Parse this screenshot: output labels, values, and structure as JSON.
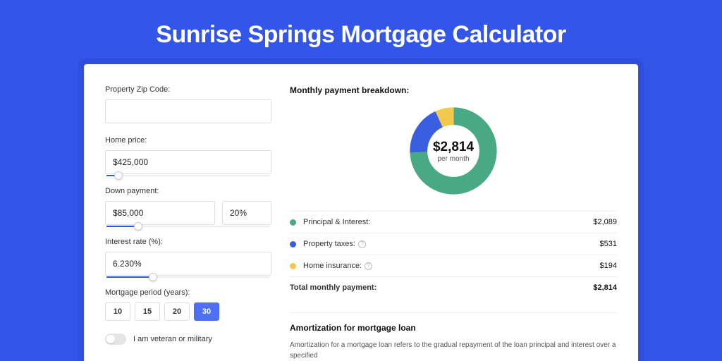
{
  "title": "Sunrise Springs Mortgage Calculator",
  "colors": {
    "green": "#4aa985",
    "blue": "#3a5ee0",
    "yellow": "#f2c94c"
  },
  "form": {
    "zip": {
      "label": "Property Zip Code:",
      "value": ""
    },
    "price": {
      "label": "Home price:",
      "value": "$425,000",
      "slider_pct": 8
    },
    "down": {
      "label": "Down payment:",
      "amount": "$85,000",
      "percent": "20%",
      "slider_pct": 20
    },
    "rate": {
      "label": "Interest rate (%):",
      "value": "6.230%",
      "slider_pct": 29
    },
    "period": {
      "label": "Mortgage period (years):",
      "options": [
        "10",
        "15",
        "20",
        "30"
      ],
      "selected": "30"
    },
    "veteran": {
      "label": "I am veteran or military",
      "on": false
    }
  },
  "breakdown": {
    "title": "Monthly payment breakdown:",
    "center_amount": "$2,814",
    "center_sub": "per month",
    "items": [
      {
        "name": "Principal & Interest:",
        "value": "$2,089",
        "color": "#4aa985",
        "help": false
      },
      {
        "name": "Property taxes:",
        "value": "$531",
        "color": "#3a5ee0",
        "help": true
      },
      {
        "name": "Home insurance:",
        "value": "$194",
        "color": "#f2c94c",
        "help": true
      }
    ],
    "total": {
      "label": "Total monthly payment:",
      "value": "$2,814"
    }
  },
  "chart_data": {
    "type": "pie",
    "title": "Monthly payment breakdown",
    "series": [
      {
        "name": "Principal & Interest",
        "value": 2089,
        "color": "#4aa985"
      },
      {
        "name": "Property taxes",
        "value": 531,
        "color": "#3a5ee0"
      },
      {
        "name": "Home insurance",
        "value": 194,
        "color": "#f2c94c"
      }
    ],
    "total": 2814,
    "inner_radius_ratio": 0.62
  },
  "amortization": {
    "title": "Amortization for mortgage loan",
    "body": "Amortization for a mortgage loan refers to the gradual repayment of the loan principal and interest over a specified"
  }
}
